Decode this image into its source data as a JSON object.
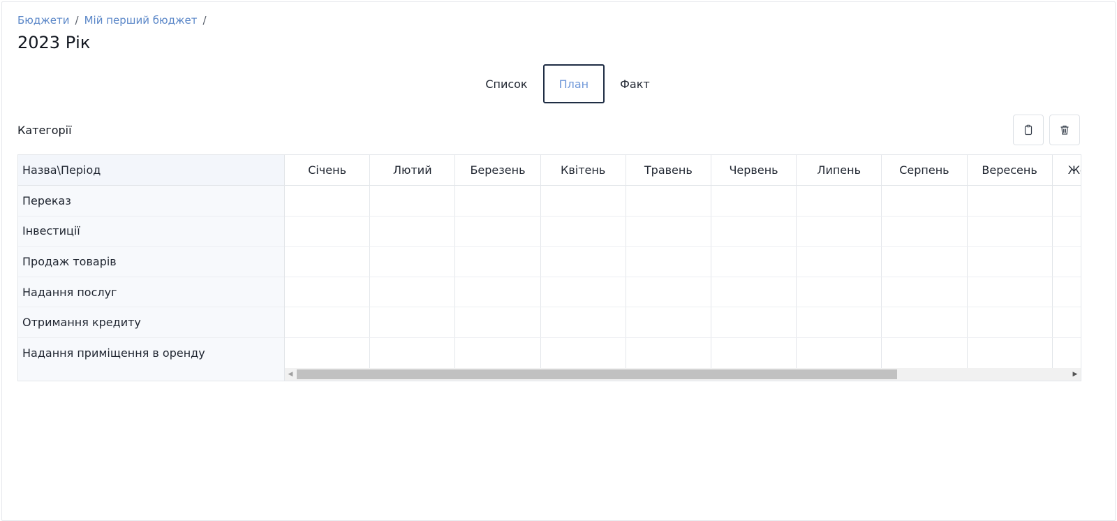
{
  "breadcrumb": {
    "items": [
      "Бюджети",
      "Мій перший бюджет"
    ],
    "separator": "/"
  },
  "page_title": "2023 Рік",
  "tabs": [
    {
      "label": "Список",
      "active": false
    },
    {
      "label": "План",
      "active": true
    },
    {
      "label": "Факт",
      "active": false
    }
  ],
  "section": {
    "title": "Категорії",
    "actions": [
      {
        "icon": "clipboard-icon"
      },
      {
        "icon": "trash-icon"
      }
    ]
  },
  "table": {
    "corner_header": "Назва\\Період",
    "months": [
      "Січень",
      "Лютий",
      "Березень",
      "Квітень",
      "Травень",
      "Червень",
      "Липень",
      "Серпень",
      "Вересень",
      "Жовтень"
    ],
    "rows": [
      "Переказ",
      "Інвестиції",
      "Продаж товарів",
      "Надання послуг",
      "Отримання кредиту",
      "Надання приміщення в оренду"
    ]
  },
  "colors": {
    "link": "#5b87c8",
    "active_tab_text": "#6d96d8",
    "active_tab_border": "#1f2d44",
    "pinned_bg": "#f7f9fc"
  }
}
